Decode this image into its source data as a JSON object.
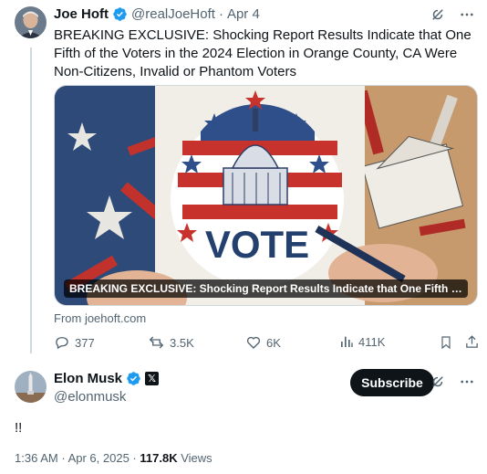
{
  "tweet": {
    "author_name": "Joe Hoft",
    "handle": "@realJoeHoft",
    "separator": "·",
    "date": "Apr 4",
    "text": "BREAKING EXCLUSIVE: Shocking Report Results Indicate that One Fifth of the Voters in the 2024 Election in Orange County, CA Were Non-Citizens, Invalid or Phantom Voters",
    "media": {
      "caption": "BREAKING EXCLUSIVE: Shocking Report Results Indicate that One Fifth of the ...",
      "vote_text": "VOTE"
    },
    "source": "From joehoft.com",
    "stats": {
      "replies": "377",
      "reposts": "3.5K",
      "likes": "6K",
      "views": "411K"
    }
  },
  "reply": {
    "author_name": "Elon Musk",
    "handle": "@elonmusk",
    "subscribe_label": "Subscribe",
    "text": "!!",
    "time": "1:36 AM",
    "separator": "·",
    "date": "Apr 6, 2025",
    "views_count": "117.8K",
    "views_label": "Views"
  },
  "colors": {
    "verified_blue": "#1d9bf0",
    "text_primary": "#0f1419",
    "text_secondary": "#536471"
  },
  "icons": [
    "verified-badge-icon",
    "grok-icon",
    "more-icon",
    "reply-icon",
    "repost-icon",
    "like-icon",
    "views-icon",
    "bookmark-icon",
    "share-icon",
    "x-logo-icon"
  ]
}
